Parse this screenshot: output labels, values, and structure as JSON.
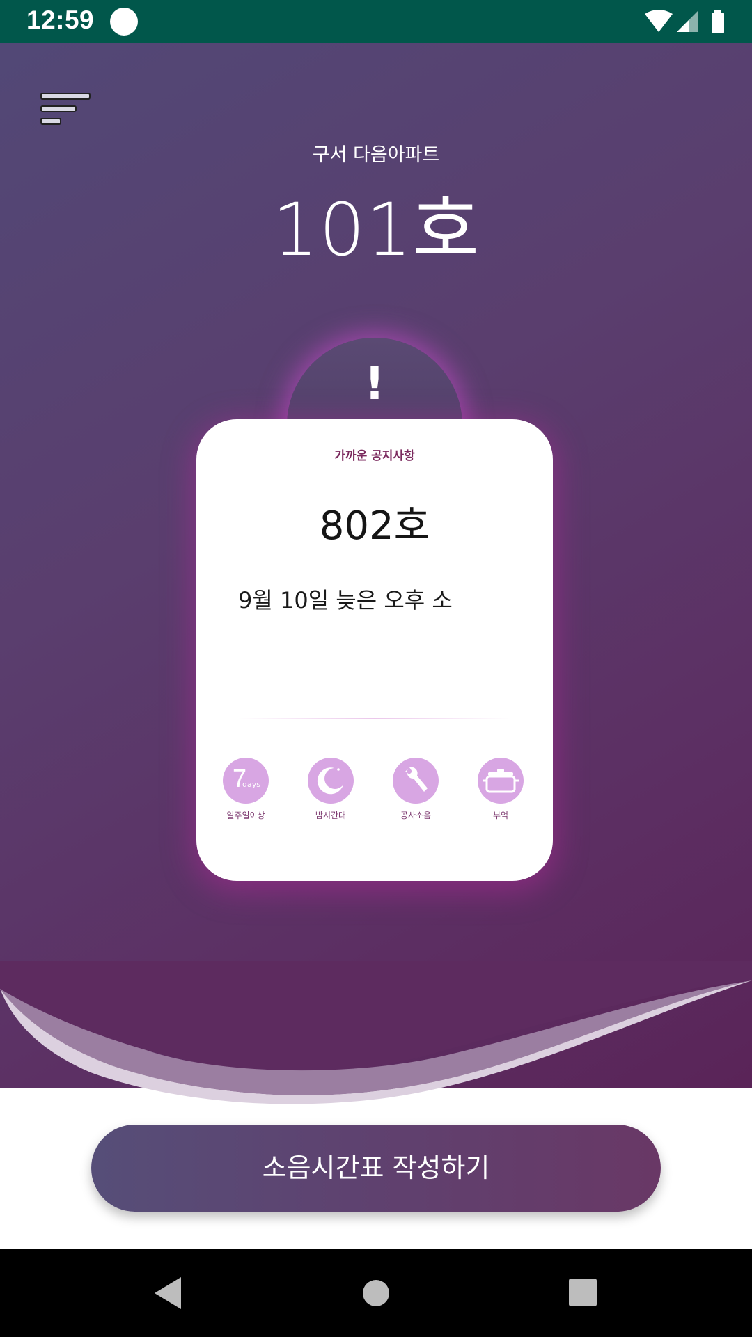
{
  "status_bar": {
    "time": "12:59"
  },
  "header": {
    "apartment": "구서 다음아파트",
    "unit": "101호"
  },
  "alert": {
    "symbol": "!"
  },
  "card": {
    "label": "가까운 공지사항",
    "unit": "802호",
    "message": "9월 10일 늦은 오후 소",
    "categories": [
      {
        "label": "일주일이상",
        "icon": "seven-days-icon",
        "icon_text": "7",
        "icon_sub": "days"
      },
      {
        "label": "밤시간대",
        "icon": "moon-icon"
      },
      {
        "label": "공사소음",
        "icon": "wrench-icon"
      },
      {
        "label": "부엌",
        "icon": "pot-icon"
      }
    ]
  },
  "cta": {
    "label": "소음시간표 작성하기"
  },
  "colors": {
    "status_bar": "#01574b",
    "hero_start": "#524876",
    "hero_end": "#5a2458",
    "category_circle": "#d8a6e3",
    "card_label": "#7b2a5e",
    "glow": "#d44cd6"
  }
}
